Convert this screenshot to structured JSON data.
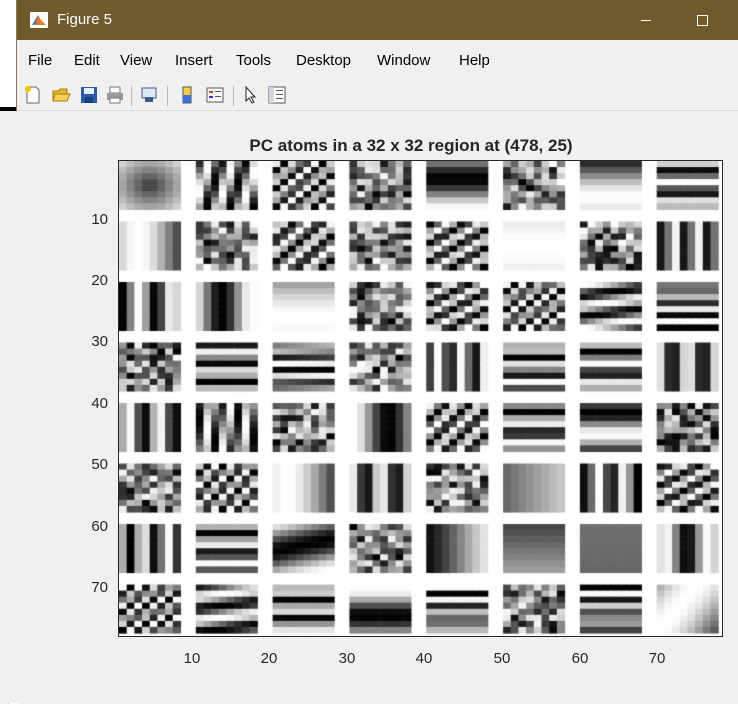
{
  "window": {
    "title": "Figure 5",
    "minimize_label": "—",
    "maximize_label": "☐"
  },
  "menu": [
    "File",
    "Edit",
    "View",
    "Insert",
    "Tools",
    "Desktop",
    "Window",
    "Help"
  ],
  "toolbar": {
    "icons": [
      "new-figure-icon",
      "open-file-icon",
      "save-icon",
      "print-icon",
      "link-plot-icon",
      "colorbar-icon",
      "legend-icon",
      "edit-plot-icon",
      "property-inspector-icon"
    ]
  },
  "plot": {
    "title": "PC atoms in a 32 x 32 region at (478, 25)",
    "y_ticks": [
      "10",
      "20",
      "30",
      "40",
      "50",
      "60",
      "70"
    ],
    "x_ticks": [
      "10",
      "20",
      "30",
      "40",
      "50",
      "60",
      "70"
    ],
    "grid_rows": 8,
    "grid_cols": 8,
    "atom_size": 8,
    "colormap": "gray"
  }
}
